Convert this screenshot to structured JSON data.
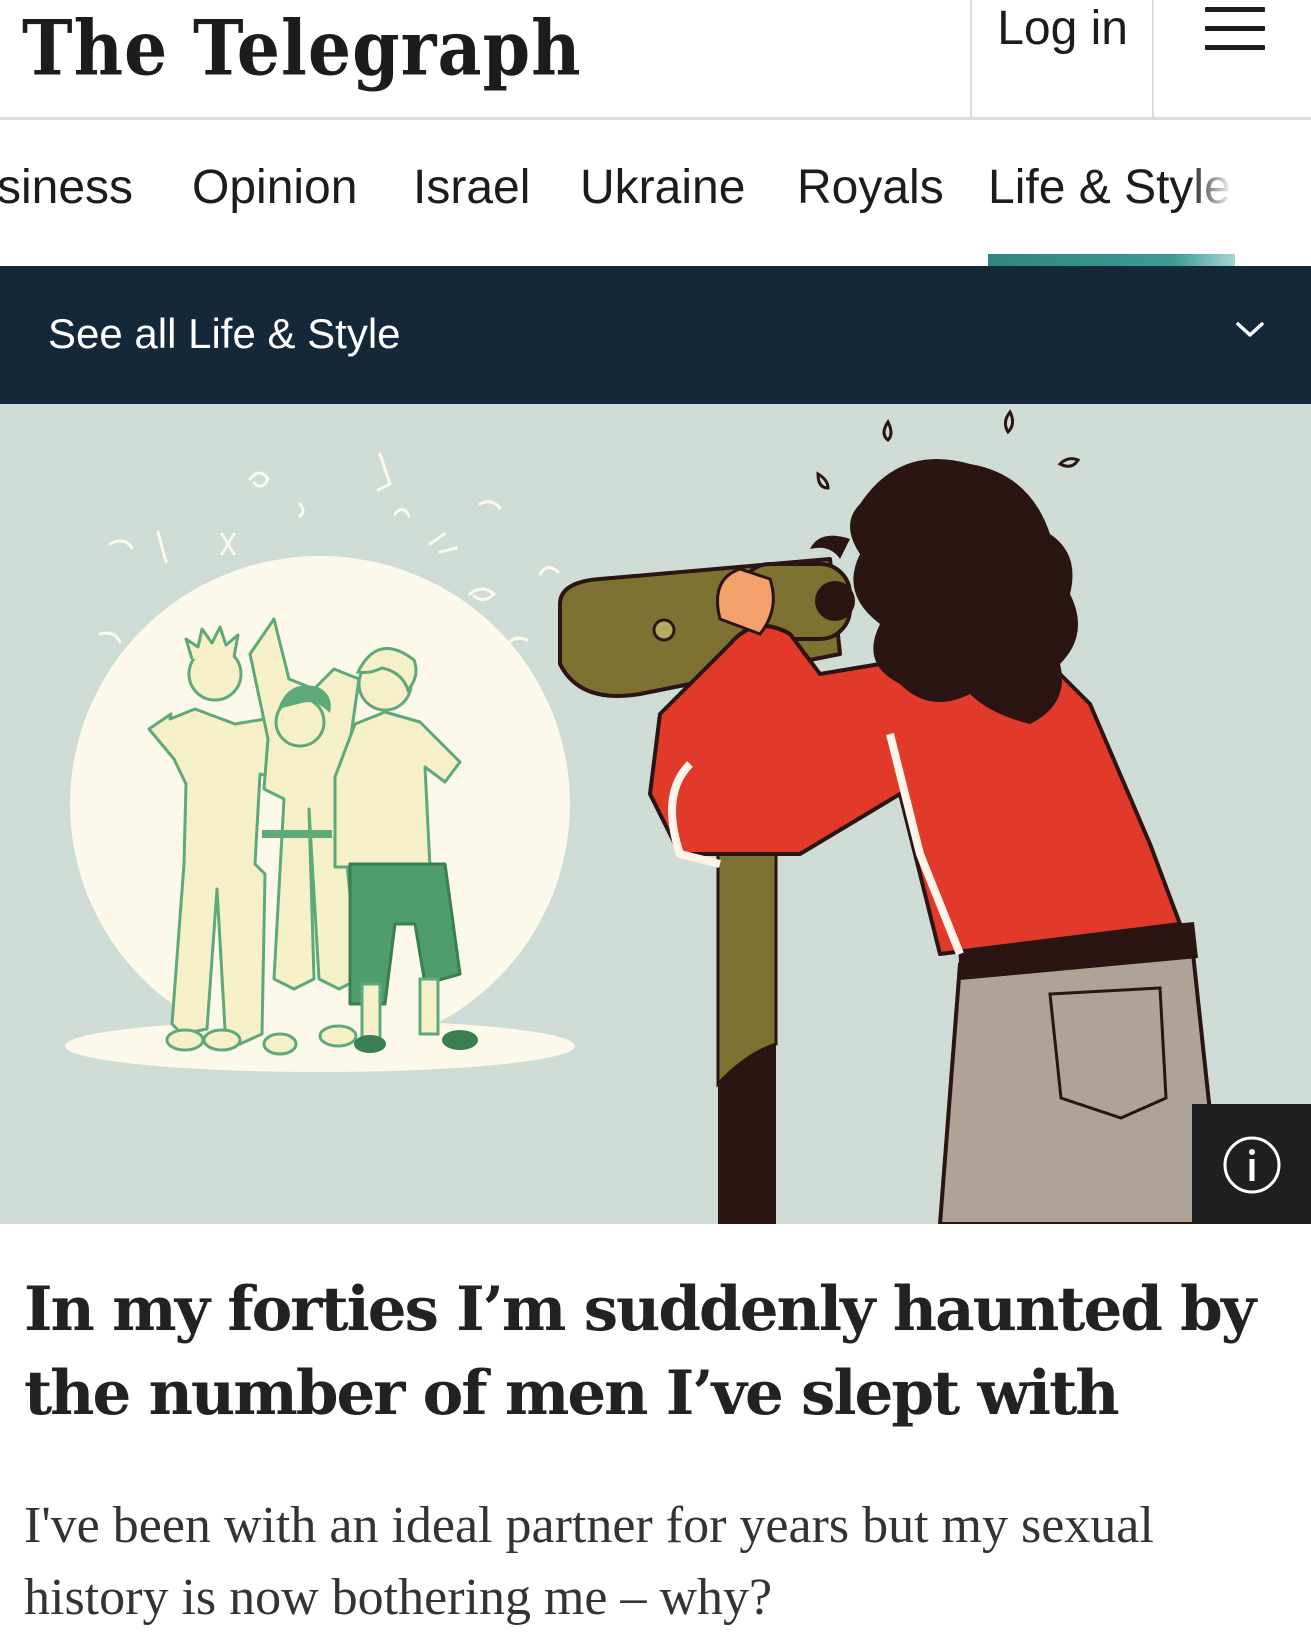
{
  "header": {
    "logo_text": "The Telegraph",
    "login_label": "Log in",
    "menu_icon": "hamburger-menu-icon"
  },
  "nav": {
    "items": [
      {
        "label": "siness"
      },
      {
        "label": "Opinion"
      },
      {
        "label": "Israel"
      },
      {
        "label": "Ukraine"
      },
      {
        "label": "Royals"
      },
      {
        "label": "Life & Style"
      }
    ],
    "active_index": 5,
    "active_color": "#2e8582"
  },
  "subnav": {
    "label": "See all Life & Style",
    "chevron_icon": "chevron-down-icon",
    "background": "#15283a"
  },
  "hero": {
    "alt_icon": "info-icon",
    "background": "#cfdcd6"
  },
  "article": {
    "headline": "In my forties I’m suddenly haunted by the number of men I’ve slept with",
    "standfirst": "I've been with an ideal partner for years but my sexual history is now bothering me – why?"
  }
}
